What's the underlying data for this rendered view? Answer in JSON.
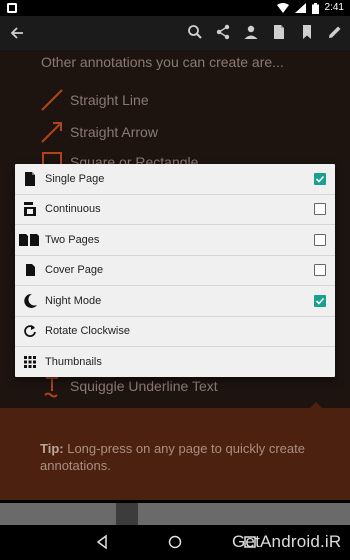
{
  "status_bar": {
    "time": "2:41"
  },
  "toolbar": {
    "back_icon": "arrow-left-icon",
    "actions": [
      "search-icon",
      "share-icon",
      "account-icon",
      "page-icon",
      "bookmark-icon",
      "pen-icon"
    ]
  },
  "document": {
    "intro": "Other annotations you can create are...",
    "annotations": [
      {
        "label": "Straight Line",
        "icon": "line-icon"
      },
      {
        "label": "Straight Arrow",
        "icon": "arrow-icon"
      },
      {
        "label": "Square or Rectangle",
        "icon": "square-icon"
      },
      {
        "label": "Squiggle Underline Text",
        "icon": "text-underline-icon"
      }
    ],
    "tip_label": "Tip:",
    "tip_text": "Long-press on any page to quickly create annotations."
  },
  "menu": {
    "items": [
      {
        "label": "Single Page",
        "icon": "single-page-icon",
        "checkbox": true,
        "checked": true
      },
      {
        "label": "Continuous",
        "icon": "continuous-icon",
        "checkbox": true,
        "checked": false
      },
      {
        "label": "Two Pages",
        "icon": "two-pages-icon",
        "checkbox": true,
        "checked": false
      },
      {
        "label": "Cover Page",
        "icon": "cover-page-icon",
        "checkbox": true,
        "checked": false
      },
      {
        "label": "Night Mode",
        "icon": "moon-icon",
        "checkbox": true,
        "checked": true
      },
      {
        "label": "Rotate Clockwise",
        "icon": "rotate-icon",
        "checkbox": false,
        "checked": false
      },
      {
        "label": "Thumbnails",
        "icon": "grid-icon",
        "checkbox": false,
        "checked": false
      }
    ]
  },
  "watermark": "GetAndroid.iR",
  "colors": {
    "accent": "#1a9f93",
    "annotation": "#b04418",
    "bubble": "#4d2110"
  }
}
